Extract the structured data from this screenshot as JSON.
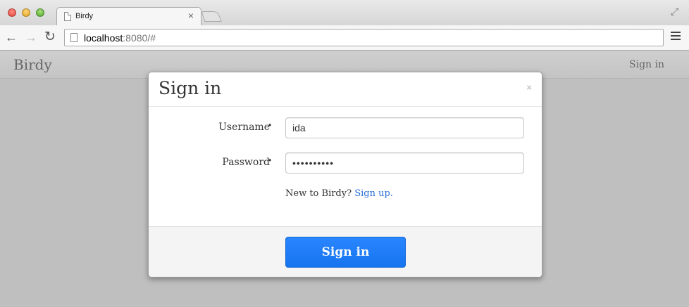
{
  "browser": {
    "tab_title": "Birdy",
    "tab_close": "×",
    "url_host": "localhost",
    "url_port": ":8080",
    "url_path": "/#"
  },
  "navbar": {
    "brand": "Birdy",
    "signin_link": "Sign in"
  },
  "modal": {
    "title": "Sign in",
    "close": "×",
    "username_label": "Username",
    "username_value": "ida",
    "password_label": "Password",
    "password_value": "••••••••••",
    "required_marker": "•",
    "signup_prompt": "New to Birdy?",
    "signup_link": "Sign up.",
    "submit_label": "Sign in"
  },
  "colors": {
    "primary": "#1a7bff",
    "link": "#2a6fd6"
  }
}
